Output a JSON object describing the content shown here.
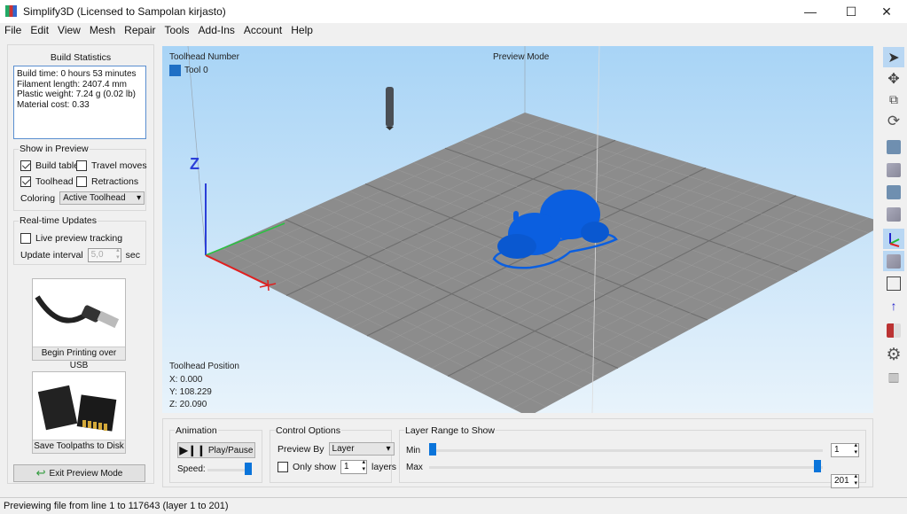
{
  "window": {
    "title": "Simplify3D (Licensed to Sampolan kirjasto)",
    "minimize": "—",
    "maximize": "☐",
    "close": "✕"
  },
  "menu": [
    "File",
    "Edit",
    "View",
    "Mesh",
    "Repair",
    "Tools",
    "Add-Ins",
    "Account",
    "Help"
  ],
  "build_stats": {
    "title": "Build Statistics",
    "lines": [
      "Build time: 0 hours 53 minutes",
      "Filament length: 2407.4 mm",
      "Plastic weight: 7.24 g (0.02 lb)",
      "Material cost: 0.33"
    ]
  },
  "show_in_preview": {
    "title": "Show in Preview",
    "build_table": {
      "label": "Build table",
      "checked": true
    },
    "travel_moves": {
      "label": "Travel moves",
      "checked": false
    },
    "toolhead": {
      "label": "Toolhead",
      "checked": true
    },
    "retractions": {
      "label": "Retractions",
      "checked": false
    },
    "coloring_label": "Coloring",
    "coloring_value": "Active Toolhead"
  },
  "realtime": {
    "title": "Real-time Updates",
    "live_label": "Live preview tracking",
    "live_checked": false,
    "interval_label": "Update interval",
    "interval_value": "5,0",
    "interval_unit": "sec"
  },
  "usb_button": "Begin Printing over USB",
  "disk_button": "Save Toolpaths to Disk",
  "exit_button": "Exit Preview Mode",
  "viewport": {
    "toolhead_number": "Toolhead Number",
    "tool0": "Tool 0",
    "tool_color": "#1f6fc5",
    "mode": "Preview Mode",
    "z_axis": "Z",
    "position_title": "Toolhead Position",
    "x": "X: 0.000",
    "y": "Y: 108.229",
    "z": "Z: 20.090",
    "model_color": "#0b5fe0"
  },
  "animation": {
    "title": "Animation",
    "play": "Play/Pause",
    "speed_label": "Speed:",
    "speed": 1.0
  },
  "control": {
    "title": "Control Options",
    "preview_by_label": "Preview By",
    "preview_by": "Layer",
    "only_show_label": "Only show",
    "only_show_checked": false,
    "only_show_value": "1",
    "layers_label": "layers"
  },
  "layer_range": {
    "title": "Layer Range to Show",
    "min_label": "Min",
    "max_label": "Max",
    "min": "1",
    "max": "201",
    "total": 201
  },
  "toolbar": [
    "select-arrow",
    "move",
    "scale",
    "rotate",
    "view-front",
    "view-back",
    "view-left",
    "view-right",
    "axes",
    "view-iso",
    "wireframe",
    "z-axis",
    "cross-section",
    "settings",
    "machine"
  ],
  "status": "Previewing file from line 1 to 117643 (layer 1 to 201)"
}
